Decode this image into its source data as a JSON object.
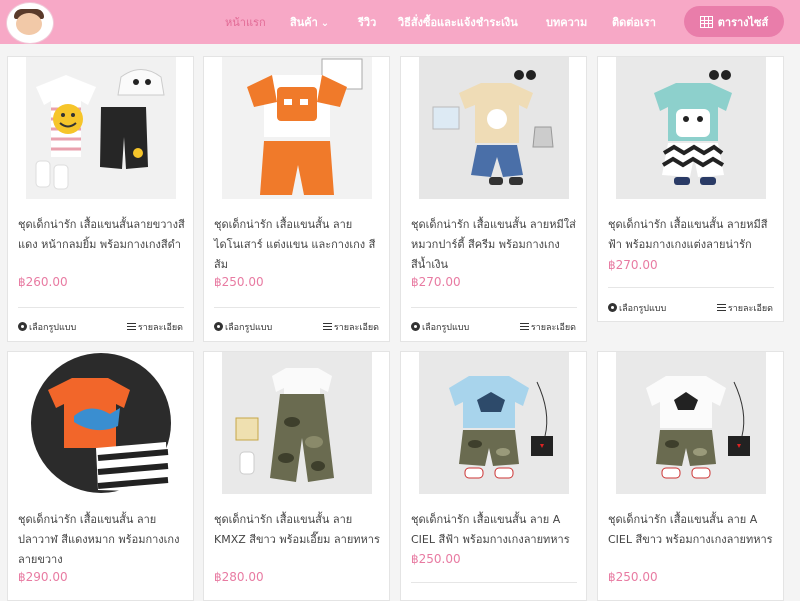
{
  "nav": {
    "items": [
      {
        "label": "หน้าแรก",
        "active": true
      },
      {
        "label": "สินค้า",
        "has_dropdown": true
      },
      {
        "label": "รีวิว"
      },
      {
        "label": "วิธีสั่งซื้อและแจ้งชำระเงิน"
      },
      {
        "label": "บทความ"
      },
      {
        "label": "ติดต่อเรา"
      }
    ],
    "size_button": "ตารางไซส์"
  },
  "brand_colors": {
    "nav_bg": "#f7a8c6",
    "accent": "#e97daa",
    "price": "#e87ba2"
  },
  "actions": {
    "choose_style": "เลือกรูปแบบ",
    "details": "รายละเอียด"
  },
  "products": [
    {
      "name": "ชุดเด็กน่ารัก เสื้อแขนสั้นลายขวางสีแดง หน้ากลมยิ้ม พร้อมกางเกงสีดำ",
      "price": "฿260.00"
    },
    {
      "name": "ชุดเด็กน่ารัก เสื้อแขนสั้น ลายไดโนเสาร์ แต่งแขน และกางเกง สีส้ม",
      "price": "฿250.00"
    },
    {
      "name": "ชุดเด็กน่ารัก เสื้อแขนสั้น ลายหมีใส่หมวกปาร์ตี้ สีครีม พร้อมกางเกงสีน้ำเงิน",
      "price": "฿270.00"
    },
    {
      "name": "ชุดเด็กน่ารัก เสื้อแขนสั้น ลายหมีสีฟ้า พร้อมกางเกงแต่งลายน่ารัก",
      "price": "฿270.00"
    },
    {
      "name": "ชุดเด็กน่ารัก เสื้อแขนสั้น ลายปลาวาฬ สีแดงหมาก พร้อมกางเกงลายขวาง",
      "price": "฿290.00"
    },
    {
      "name": "ชุดเด็กน่ารัก เสื้อแขนสั้น ลาย KMXZ สีขาว พร้อมเอี๊ยม ลายทหาร",
      "price": "฿280.00"
    },
    {
      "name": "ชุดเด็กน่ารัก เสื้อแขนสั้น ลาย A CIEL สีฟ้า พร้อมกางเกงลายทหาร",
      "price": "฿250.00"
    },
    {
      "name": "ชุดเด็กน่ารัก เสื้อแขนสั้น ลาย A CIEL สีขาว พร้อมกางเกงลายทหาร",
      "price": "฿250.00"
    }
  ]
}
